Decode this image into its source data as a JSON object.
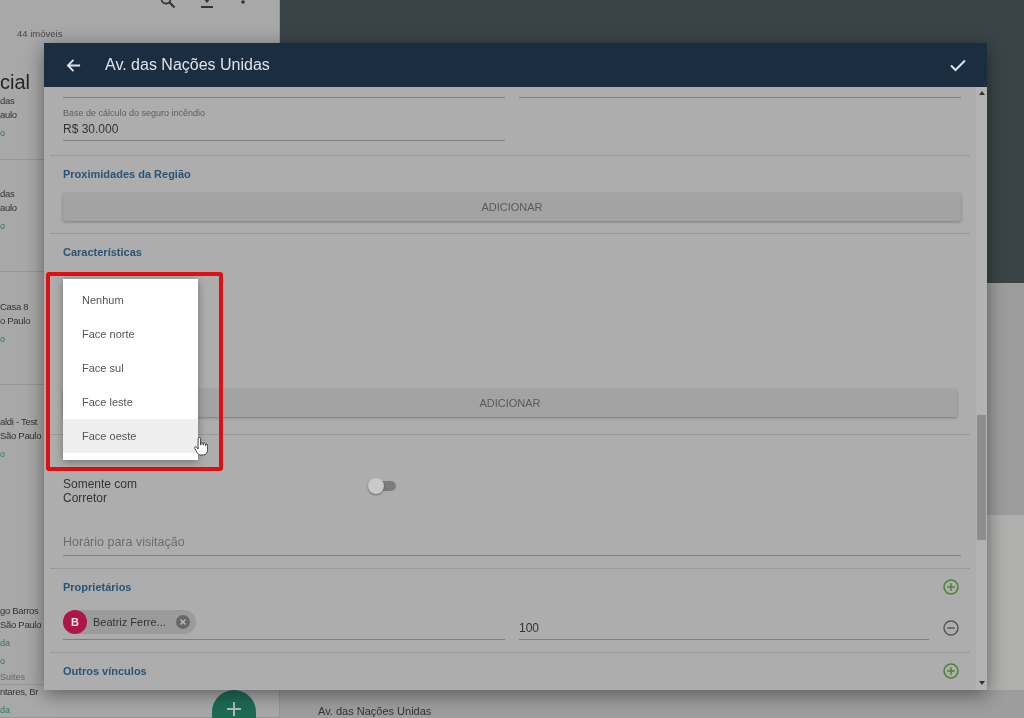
{
  "background": {
    "list_count": "44 imóveis",
    "listings": [
      {
        "lines": [
          {
            "kind": "title",
            "text": "cial"
          },
          {
            "kind": "address",
            "text": "das"
          },
          {
            "kind": "address",
            "text": "aulo"
          },
          {
            "kind": "tag",
            "text": "o"
          }
        ]
      },
      {
        "lines": [
          {
            "kind": "address",
            "text": "das"
          },
          {
            "kind": "address",
            "text": "aulo"
          },
          {
            "kind": "tag",
            "text": "o"
          }
        ]
      },
      {
        "lines": [
          {
            "kind": "address",
            "text": "Casa 8"
          },
          {
            "kind": "address",
            "text": "o Paulo"
          },
          {
            "kind": "tag",
            "text": "o"
          }
        ]
      },
      {
        "lines": [
          {
            "kind": "address",
            "text": "aldi - Test"
          },
          {
            "kind": "address",
            "text": "São Paulo"
          },
          {
            "kind": "tag",
            "text": "o"
          }
        ]
      },
      {
        "lines": [
          {
            "kind": "address",
            "text": "go Barros"
          },
          {
            "kind": "address",
            "text": "São Paulo"
          },
          {
            "kind": "tag",
            "text": "da"
          },
          {
            "kind": "tag",
            "text": "o"
          },
          {
            "kind": "note",
            "text": "Suites"
          }
        ]
      },
      {
        "lines": [
          {
            "kind": "address",
            "text": "ntares, Br"
          },
          {
            "kind": "tag",
            "text": "da"
          }
        ]
      }
    ],
    "map_caption": "Av. das Nações Unidas"
  },
  "dialog": {
    "title": "Av. das Nações Unidas",
    "insurance_base": {
      "label": "Base de cálculo do seguro incêndio",
      "value": "R$ 30.000"
    },
    "region": {
      "title": "Proximidades da Região",
      "button": "ADICIONAR"
    },
    "features": {
      "title": "Características",
      "button": "ADICIONAR"
    },
    "broker_only": {
      "label": "Somente com Corretor",
      "on": false
    },
    "visit_hours": {
      "placeholder": "Horário para visitação"
    },
    "owners": {
      "title": "Proprietários",
      "rows": [
        {
          "initial": "B",
          "name": "Beatriz Ferre...",
          "share": "100"
        }
      ]
    },
    "other_links": {
      "title": "Outros vínculos"
    }
  },
  "dropdown": {
    "options": [
      {
        "label": "Nenhum",
        "selected": false
      },
      {
        "label": "Face norte",
        "selected": false
      },
      {
        "label": "Face sul",
        "selected": false
      },
      {
        "label": "Face leste",
        "selected": false
      },
      {
        "label": "Face oeste",
        "selected": true
      }
    ]
  }
}
